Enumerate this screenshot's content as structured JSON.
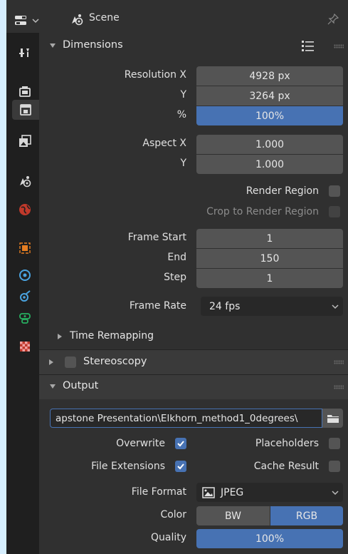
{
  "header": {
    "scene_label": "Scene"
  },
  "sidebar": {
    "tabs": [
      {
        "icon": "tool-icon"
      },
      {
        "icon": "render-icon"
      },
      {
        "icon": "output-icon",
        "active": true
      },
      {
        "icon": "view-layer-icon"
      },
      {
        "icon": "scene-icon"
      },
      {
        "icon": "world-icon"
      },
      {
        "icon": "object-icon"
      },
      {
        "icon": "modifier-icon"
      },
      {
        "icon": "particles-icon"
      },
      {
        "icon": "physics-icon"
      },
      {
        "icon": "texture-icon"
      }
    ]
  },
  "dimensions": {
    "title": "Dimensions",
    "resolution_x_label": "Resolution X",
    "resolution_x": "4928 px",
    "resolution_y_label": "Y",
    "resolution_y": "3264 px",
    "percent_label": "%",
    "percent": "100%",
    "aspect_x_label": "Aspect X",
    "aspect_x": "1.000",
    "aspect_y_label": "Y",
    "aspect_y": "1.000",
    "render_region_label": "Render Region",
    "crop_label": "Crop to Render Region",
    "frame_start_label": "Frame Start",
    "frame_start": "1",
    "end_label": "End",
    "end": "150",
    "step_label": "Step",
    "step": "1",
    "frame_rate_label": "Frame Rate",
    "frame_rate": "24 fps",
    "time_remapping_label": "Time Remapping"
  },
  "stereoscopy": {
    "title": "Stereoscopy"
  },
  "output": {
    "title": "Output",
    "path": "apstone Presentation\\Elkhorn_method1_0degrees\\",
    "overwrite_label": "Overwrite",
    "placeholders_label": "Placeholders",
    "file_extensions_label": "File Extensions",
    "cache_result_label": "Cache Result",
    "file_format_label": "File Format",
    "file_format": "JPEG",
    "color_label": "Color",
    "color_bw": "BW",
    "color_rgb": "RGB",
    "quality_label": "Quality",
    "quality": "100%"
  },
  "colors": {
    "accent": "#4772b3",
    "field": "#545454",
    "panel": "#303030"
  }
}
